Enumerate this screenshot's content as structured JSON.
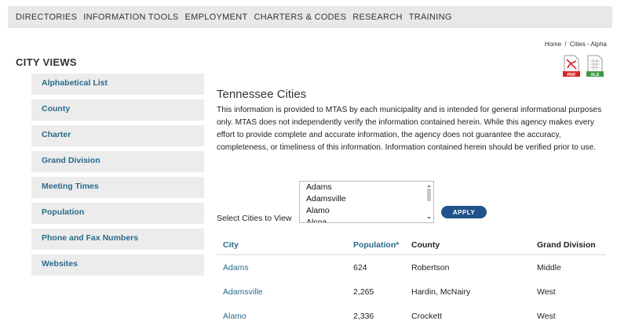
{
  "nav": [
    "DIRECTORIES",
    "INFORMATION TOOLS",
    "EMPLOYMENT",
    "CHARTERS & CODES",
    "RESEARCH",
    "TRAINING"
  ],
  "breadcrumb": {
    "home": "Home",
    "sep": "/",
    "current": "Cities - Alpha"
  },
  "file_icons": {
    "pdf": "PDF",
    "xls": "XLS"
  },
  "sidebar": {
    "title": "CITY VIEWS",
    "items": [
      "Alphabetical List",
      "County",
      "Charter",
      "Grand Division",
      "Meeting Times",
      "Population",
      "Phone and Fax Numbers",
      "Websites"
    ]
  },
  "main": {
    "title": "Tennessee Cities",
    "description": "This information is provided to MTAS by each municipality and is intended for general informational purposes only. MTAS does not independently verify the information contained herein. While this agency makes every effort to provide complete and accurate information, the agency does not guarantee the accuracy, completeness, or timeliness of this information. Information contained herein should be verified prior to use."
  },
  "selector": {
    "label": "Select Cities to View",
    "options": [
      "Adams",
      "Adamsville",
      "Alamo",
      "Alcoa"
    ],
    "apply_label": "APPLY"
  },
  "table": {
    "headers": [
      "City",
      "Population*",
      "County",
      "Grand Division"
    ],
    "rows": [
      [
        "Adams",
        "624",
        "Robertson",
        "Middle"
      ],
      [
        "Adamsville",
        "2,265",
        "Hardin, McNairy",
        "West"
      ],
      [
        "Alamo",
        "2,336",
        "Crockett",
        "West"
      ]
    ]
  },
  "colors": {
    "link": "#2a6a8c",
    "button": "#21538a",
    "pdf_red": "#d9262a",
    "xls_green": "#3f9a3f"
  }
}
